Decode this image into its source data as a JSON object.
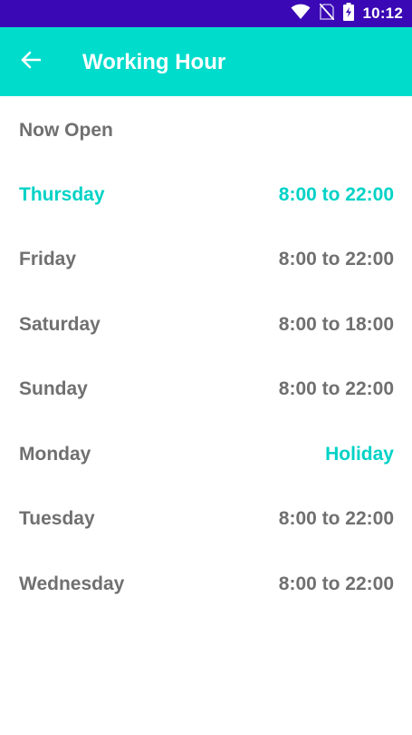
{
  "status_bar": {
    "time": "10:12",
    "background_color": "#3a08b4",
    "icons": [
      "wifi-icon",
      "no-sim-icon",
      "battery-charging-icon"
    ]
  },
  "app_bar": {
    "title": "Working Hour",
    "background_color": "#00dccc",
    "back_icon": "arrow-left-icon"
  },
  "section": {
    "title": "Now Open"
  },
  "schedule": [
    {
      "day": "Thursday",
      "hours": "8:00 to 22:00",
      "highlight_day": true,
      "highlight_hours": true
    },
    {
      "day": "Friday",
      "hours": "8:00 to 22:00",
      "highlight_day": false,
      "highlight_hours": false
    },
    {
      "day": "Saturday",
      "hours": "8:00 to 18:00",
      "highlight_day": false,
      "highlight_hours": false
    },
    {
      "day": "Sunday",
      "hours": "8:00 to 22:00",
      "highlight_day": false,
      "highlight_hours": false
    },
    {
      "day": "Monday",
      "hours": "Holiday",
      "highlight_day": false,
      "highlight_hours": true
    },
    {
      "day": "Tuesday",
      "hours": "8:00 to 22:00",
      "highlight_day": false,
      "highlight_hours": false
    },
    {
      "day": "Wednesday",
      "hours": "8:00 to 22:00",
      "highlight_day": false,
      "highlight_hours": false
    }
  ],
  "colors": {
    "accent": "#00d2c6",
    "text": "#707070"
  }
}
